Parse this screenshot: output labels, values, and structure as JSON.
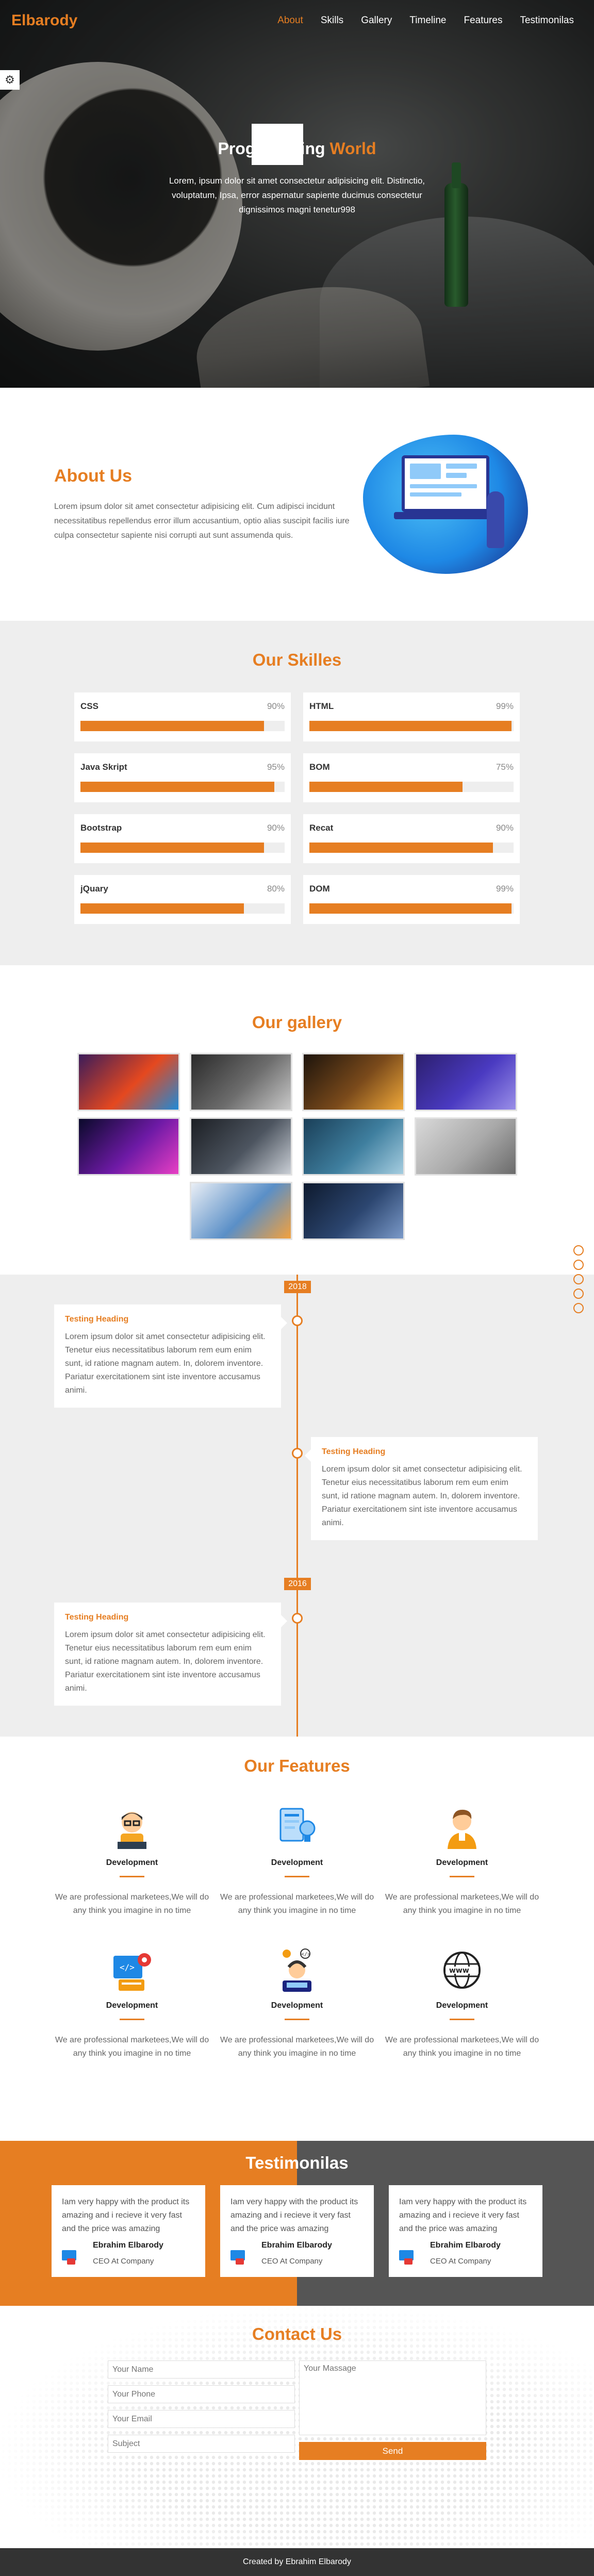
{
  "brand": {
    "logo": "Elbarody",
    "accent": "#e67e22"
  },
  "nav": {
    "items": [
      {
        "label": "About",
        "active": true
      },
      {
        "label": "Skills"
      },
      {
        "label": "Gallery"
      },
      {
        "label": "Timeline"
      },
      {
        "label": "Features"
      },
      {
        "label": "Testimonilas"
      }
    ]
  },
  "settings": {
    "icon": "gear-icon"
  },
  "hero": {
    "title_prefix": "Programming",
    "title_accent": "World",
    "description": "Lorem, ipsum dolor sit amet consectetur adipisicing elit. Distinctio, voluptatum, Ipsa, error aspernatur sapiente ducimus consectetur dignissimos magni tenetur998"
  },
  "about": {
    "title": "About Us",
    "text": "Lorem ipsum dolor sit amet consectetur adipisicing elit. Cum adipisci incidunt necessitatibus repellendus error illum accusantium, optio alias suscipit facilis iure culpa consectetur sapiente nisi corrupti aut sunt assumenda quis."
  },
  "skills": {
    "title": "Our Skilles",
    "items": [
      {
        "name": "CSS",
        "label": "90%",
        "value": 90
      },
      {
        "name": "HTML",
        "label": "99%",
        "value": 99
      },
      {
        "name": "Java Skript",
        "label": "95%",
        "value": 95
      },
      {
        "name": "BOM",
        "label": "75%",
        "value": 75
      },
      {
        "name": "Bootstrap",
        "label": "90%",
        "value": 90
      },
      {
        "name": "Recat",
        "label": "90%",
        "value": 90
      },
      {
        "name": "jQuary",
        "label": "80%",
        "value": 80
      },
      {
        "name": "DOM",
        "label": "99%",
        "value": 99
      }
    ]
  },
  "gallery": {
    "title": "Our gallery",
    "images": [
      {
        "name": "colorful-paint-image",
        "colors": [
          "#3b1c5a",
          "#e5481f",
          "#1f8ad6"
        ]
      },
      {
        "name": "laptop-hands-image",
        "colors": [
          "#2a2a2a",
          "#6d6d6d",
          "#c9c9c9"
        ]
      },
      {
        "name": "clock-image",
        "colors": [
          "#1d140c",
          "#7a4a1b",
          "#f0a93a"
        ]
      },
      {
        "name": "planet-image",
        "colors": [
          "#2c1f6e",
          "#4a3ac1",
          "#9a8fe8"
        ]
      },
      {
        "name": "neon-ring-image",
        "colors": [
          "#0a0a2a",
          "#6e1aa6",
          "#e83fc4"
        ]
      },
      {
        "name": "astronaut-image",
        "colors": [
          "#1c1f24",
          "#4d5560",
          "#c9ced5"
        ]
      },
      {
        "name": "mountain-lake-image",
        "colors": [
          "#1a3f58",
          "#3f7f9f",
          "#a5cde0"
        ]
      },
      {
        "name": "laptop-desk-image",
        "colors": [
          "#d9d9d9",
          "#a9a9a9",
          "#6b6b6b"
        ]
      },
      {
        "name": "coding-image",
        "colors": [
          "#e9eef5",
          "#5a8fc7",
          "#f3a13d"
        ]
      },
      {
        "name": "night-road-image",
        "colors": [
          "#0e1a2e",
          "#2c4670",
          "#7b9ac9"
        ]
      }
    ]
  },
  "timeline": {
    "years": [
      "2018",
      "2016"
    ],
    "cards": [
      {
        "heading": "Testing Heading",
        "text": "Lorem ipsum dolor sit amet consectetur adipisicing elit. Tenetur eius necessitatibus laborum rem eum enim sunt, id ratione magnam autem. In, dolorem inventore. Pariatur exercitationem sint iste inventore accusamus animi."
      },
      {
        "heading": "Testing Heading",
        "text": "Lorem ipsum dolor sit amet consectetur adipisicing elit. Tenetur eius necessitatibus laborum rem eum enim sunt, id ratione magnam autem. In, dolorem inventore. Pariatur exercitationem sint iste inventore accusamus animi."
      },
      {
        "heading": "Testing Heading",
        "text": "Lorem ipsum dolor sit amet consectetur adipisicing elit. Tenetur eius necessitatibus laborum rem eum enim sunt, id ratione magnam autem. In, dolorem inventore. Pariatur exercitationem sint iste inventore accusamus animi."
      }
    ]
  },
  "features": {
    "title": "Our Features",
    "items": [
      {
        "icon": "programmer-glasses-icon",
        "title": "Development",
        "text": "We are professional marketees,We will do any think you imagine in no time"
      },
      {
        "icon": "idea-document-icon",
        "title": "Development",
        "text": "We are professional marketees,We will do any think you imagine in no time"
      },
      {
        "icon": "developer-person-icon",
        "title": "Development",
        "text": "We are professional marketees,We will do any think you imagine in no time"
      },
      {
        "icon": "code-gear-icon",
        "title": "Development",
        "text": "We are professional marketees,We will do any think you imagine in no time"
      },
      {
        "icon": "coder-headset-icon",
        "title": "Development",
        "text": "We are professional marketees,We will do any think you imagine in no time"
      },
      {
        "icon": "www-globe-icon",
        "title": "Development",
        "text": "We are professional marketees,We will do any think you imagine in no time"
      }
    ]
  },
  "testimonials": {
    "title": "Testimonilas",
    "items": [
      {
        "text": "Iam very happy with the product its amazing and i recieve it very fast and the price was amazing",
        "name": "Ebrahim Elbarody",
        "role": "CEO At Company"
      },
      {
        "text": "Iam very happy with the product its amazing and i recieve it very fast and the price was amazing",
        "name": "Ebrahim Elbarody",
        "role": "CEO At Company"
      },
      {
        "text": "Iam very happy with the product its amazing and i recieve it very fast and the price was amazing",
        "name": "Ebrahim Elbarody",
        "role": "CEO At Company"
      }
    ]
  },
  "contact": {
    "title": "Contact Us",
    "name_placeholder": "Your Name",
    "phone_placeholder": "Your Phone",
    "email_placeholder": "Your Email",
    "subject_placeholder": "Subject",
    "message_placeholder": "Your Massage",
    "send_label": "Send"
  },
  "footer": {
    "text": "Created by Ebrahim Elbarody"
  }
}
